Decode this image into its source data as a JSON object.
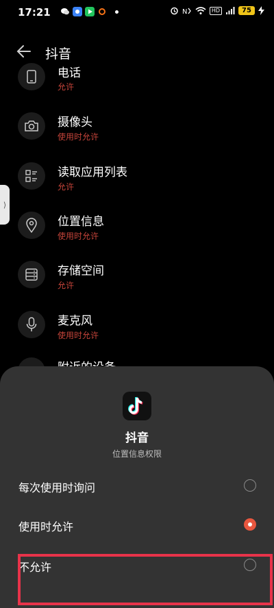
{
  "status_bar": {
    "time": "17:21",
    "battery": "75",
    "network_label": "HD",
    "accent_colors": {
      "wechat": "#2ecc71",
      "app_blue": "#3b82f6",
      "app_play": "#22c55e",
      "app_orange": "#f97316"
    }
  },
  "header": {
    "title": "抖音",
    "back_icon": "back-arrow-icon"
  },
  "permissions": [
    {
      "name": "电话",
      "status": "允许",
      "icon": "phone-icon"
    },
    {
      "name": "摄像头",
      "status": "使用时允许",
      "icon": "camera-icon"
    },
    {
      "name": "读取应用列表",
      "status": "允许",
      "icon": "app-list-icon"
    },
    {
      "name": "位置信息",
      "status": "使用时允许",
      "icon": "location-icon"
    },
    {
      "name": "存储空间",
      "status": "允许",
      "icon": "storage-icon"
    },
    {
      "name": "麦克风",
      "status": "使用时允许",
      "icon": "microphone-icon"
    },
    {
      "name": "附近的设备",
      "status": "",
      "icon": "nearby-devices-icon"
    }
  ],
  "dialog": {
    "app_name": "抖音",
    "subtitle": "位置信息权限",
    "options": [
      {
        "label": "每次使用时询问",
        "selected": false
      },
      {
        "label": "使用时允许",
        "selected": true
      },
      {
        "label": "不允许",
        "selected": false
      }
    ]
  },
  "colors": {
    "status_red": "#c6443a",
    "radio_selected": "#e9573f",
    "highlight": "#e8334a",
    "sheet_bg": "#333333"
  }
}
